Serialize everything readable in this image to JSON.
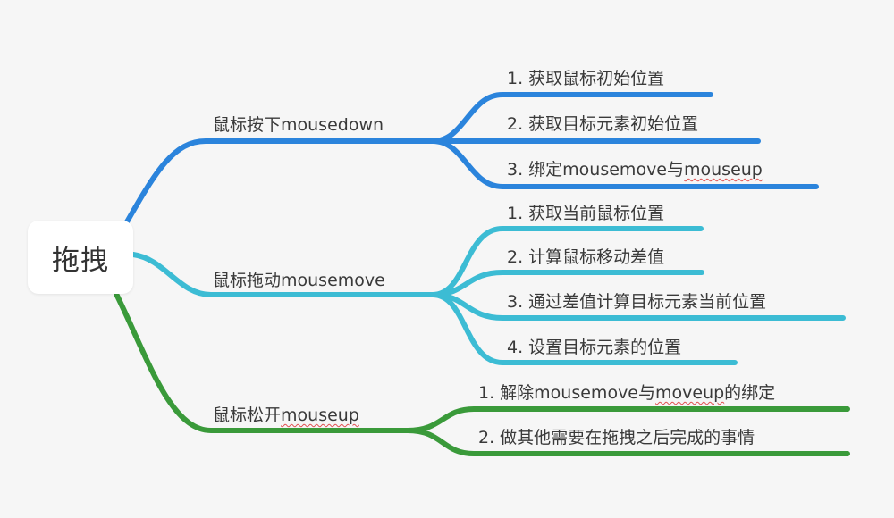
{
  "root": {
    "label": "拖拽"
  },
  "colors": {
    "blue": "#2b84dc",
    "cyan": "#3cbcd4",
    "green": "#3a9a3a"
  },
  "branches": [
    {
      "label": "鼠标按下mousedown",
      "children": [
        {
          "label": "1. 获取鼠标初始位置"
        },
        {
          "label": "2. 获取目标元素初始位置"
        },
        {
          "prefix": "3. 绑定mousemove与",
          "marked": "mouseup"
        }
      ]
    },
    {
      "label": "鼠标拖动mousemove",
      "children": [
        {
          "label": "1. 获取当前鼠标位置"
        },
        {
          "label": "2. 计算鼠标移动差值"
        },
        {
          "label": "3. 通过差值计算目标元素当前位置"
        },
        {
          "label": "4. 设置目标元素的位置"
        }
      ]
    },
    {
      "prefix": "鼠标松开",
      "marked": "mouseup",
      "children": [
        {
          "prefix": "1. 解除mousemove与",
          "marked": "moveup",
          "suffix": "的绑定"
        },
        {
          "label": "2. 做其他需要在拖拽之后完成的事情"
        }
      ]
    }
  ]
}
